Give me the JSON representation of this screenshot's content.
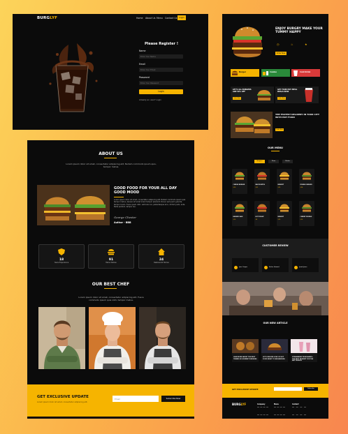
{
  "colors": {
    "accent": "#f6b400",
    "panel": "#0b0b0b",
    "field": "#1e1e1e",
    "red": "#d93a3a"
  },
  "p1": {
    "logo_a": "BURG",
    "logo_b": "LYF",
    "nav": [
      "Home",
      "About Us",
      "Menu",
      "Contact Us"
    ],
    "nav_cta": "Login",
    "form_title": "Please Register !",
    "name_label": "Name",
    "name_ph": "Enter Your Name",
    "email_label": "Email",
    "email_ph": "Enter Your Email",
    "password_label": "Password",
    "password_ph": "Enter Your Password",
    "submit": "Login",
    "footer_note": "Already an user? Login"
  },
  "p2": {
    "about_title": "ABOUT US",
    "about_text": "Lorem ipsum dolor sit amet, consectetur adipiscing elit. Nullam commodo ipsum quis, tempor metus.",
    "good_title": "GOOD FOOD FOR YOUR ALL DAY GOOD MOOD",
    "good_text": "Lorem ipsum dolor sit amet, consectetur adipiscing elit. Nullam commodo ipsum quis tempor metus. Aenean sit amet lorem tempor placerat. Donec sed quam gravida, tempor lorem. Fusce quam nibh, vehicula non, pellentesque arcu, dictum justo, ante. Nulla pretium, tempor leo.",
    "signature": "George Chester",
    "author": "Author - BBB",
    "stats": [
      {
        "value": "18",
        "label": "Years Experience"
      },
      {
        "value": "91",
        "label": "Menu Dishes"
      },
      {
        "value": "24",
        "label": "Restaurant Stores"
      }
    ],
    "chef_title": "OUR BEST CHEF",
    "chef_text": "Lorem ipsum dolor sit amet, consectetur adipiscing elit. Fusce commodo ipsum quis nibh, tempor metus.",
    "exclusive_title": "GET EXCLUSIVE UPDATE",
    "exclusive_text": "Lorem ipsum dolor sit amet, consectetur adipiscing elit.",
    "email_ph": "Email",
    "subscribe": "Subscribe Now"
  },
  "p3": {
    "hero_title": "ENJOY BURGRY MAKE YOUR TUMMY HAPPY",
    "hero_cta": "Order Now",
    "promos": [
      "Burger",
      "Combo",
      "Cold Drink"
    ],
    "promo2": [
      "LET'S ALL BURGERS ARE 50% OFF",
      "GET YOUR HOT MEAL DEALS NOW"
    ],
    "promo2_cta": "Order Now",
    "feature_title": "THE FASTEST DELIVERY IN YOUR CITY WITH HOT FOOD",
    "feature_cta": "Order Now",
    "menu_title": "OUR MENU",
    "menu_tabs": [
      "Burgers",
      "Pizza",
      "Drinks"
    ],
    "items": [
      {
        "name": "CHEESE BURGER",
        "price": "$10"
      },
      {
        "name": "BACON BITES",
        "price": "$12"
      },
      {
        "name": "BRISKET",
        "price": "$15"
      },
      {
        "name": "DOUBLE BURGER",
        "price": "$14"
      },
      {
        "name": "BURGER SALE",
        "price": "$10"
      },
      {
        "name": "HOT DOGGY",
        "price": "$8"
      },
      {
        "name": "BRISKET",
        "price": "$15"
      },
      {
        "name": "CHERRY DOUBLE",
        "price": "$16"
      }
    ],
    "testimonials_title": "CUSTOMER REVIEW",
    "reviewers": [
      "Jane Cooper",
      "Esther Howard",
      "Jacob Jones"
    ],
    "blog_title": "OUR NEW ARTICLE",
    "posts": [
      "LEAN MORE ABOUT THE BEST TRENDS IN GOURMET BURGERS",
      "LET'S DELIVER LOVE OF HOT FOOD NIGHT TO NEIGHBOURS",
      "STRAWBERRY MILKSHAKES: THE BEST DESSERT FOR THE ANY SEASON"
    ],
    "exclusive_title": "GET EXCLUSIVE UPDATE",
    "subscribe": "Subscribe",
    "footer_logo_a": "BURG",
    "footer_logo_b": "LYF",
    "footer_cols": [
      "Company",
      "Menu",
      "Contact"
    ]
  }
}
